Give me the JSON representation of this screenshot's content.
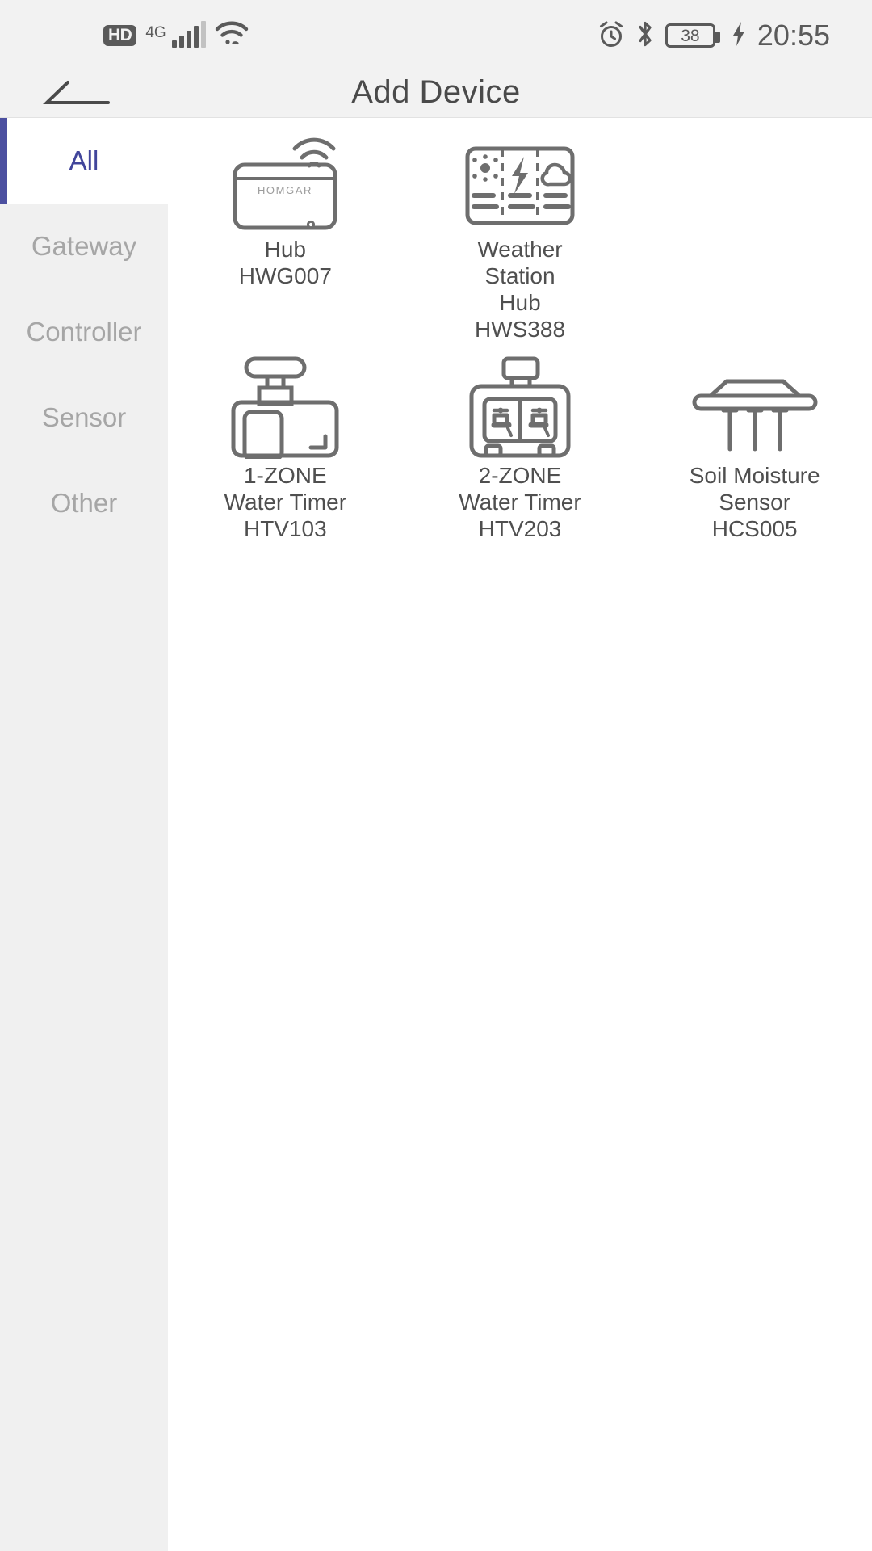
{
  "statusbar": {
    "hd_label": "HD",
    "network_type": "4G",
    "battery_level": "38",
    "time": "20:55",
    "icons": [
      "hd-icon",
      "signal-bars-icon",
      "wifi-icon",
      "alarm-clock-icon",
      "bluetooth-icon",
      "battery-icon",
      "charging-bolt-icon"
    ]
  },
  "header": {
    "title": "Add Device",
    "back_icon": "back-arrow-icon"
  },
  "sidebar": {
    "items": [
      {
        "label": "All",
        "active": true
      },
      {
        "label": "Gateway",
        "active": false
      },
      {
        "label": "Controller",
        "active": false
      },
      {
        "label": "Sensor",
        "active": false
      },
      {
        "label": "Other",
        "active": false
      }
    ],
    "active_color": "#41459b",
    "indicator_color": "#4c50a0",
    "inactive_color": "#a6a6a6"
  },
  "devices": [
    {
      "name": "Hub",
      "model": "HWG007",
      "icon": "hub-device-icon",
      "brand_text": "HOMGAR"
    },
    {
      "name": "Weather Station\nHub",
      "model": "HWS388",
      "icon": "weather-station-hub-icon"
    },
    {
      "name": "",
      "model": "",
      "icon": "empty-slot"
    },
    {
      "name": "1-ZONE\nWater Timer",
      "model": "HTV103",
      "icon": "one-zone-water-timer-icon"
    },
    {
      "name": "2-ZONE\nWater Timer",
      "model": "HTV203",
      "icon": "two-zone-water-timer-icon"
    },
    {
      "name": "Soil Moisture\nSensor",
      "model": "HCS005",
      "icon": "soil-moisture-sensor-icon"
    }
  ],
  "colors": {
    "statusbar_bg": "#f2f2f2",
    "sidebar_bg": "#f0f0f0",
    "content_bg": "#ffffff",
    "icon_stroke": "#6e6e6e",
    "text_primary": "#4f4f4f"
  }
}
